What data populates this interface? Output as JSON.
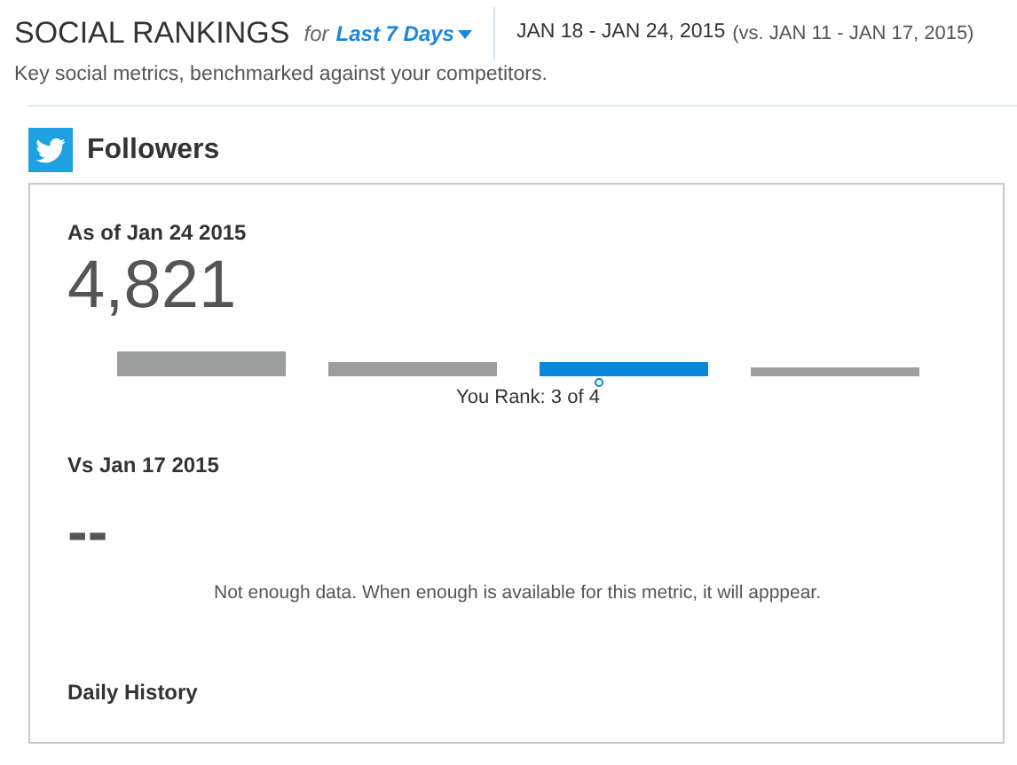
{
  "header": {
    "title": "SOCIAL RANKINGS",
    "for_label": "for",
    "period": "Last 7 Days",
    "date_range": "JAN 18 - JAN 24, 2015",
    "comparison": "(vs. JAN 11 - JAN 17, 2015)",
    "subtitle": "Key social metrics, benchmarked against your competitors."
  },
  "section": {
    "title": "Followers"
  },
  "card": {
    "as_of": "As of Jan 24 2015",
    "value": "4,821",
    "rank_bars": [
      {
        "kind": "tall",
        "selected": false
      },
      {
        "kind": "medium",
        "selected": false
      },
      {
        "kind": "medium",
        "selected": true
      },
      {
        "kind": "short",
        "selected": false
      }
    ],
    "rank_label": "You Rank: 3 of 4",
    "vs_label": "Vs Jan 17 2015",
    "vs_value": "--",
    "note": "Not enough data. When enough is available for this metric, it will apppear.",
    "history_label": "Daily History"
  }
}
